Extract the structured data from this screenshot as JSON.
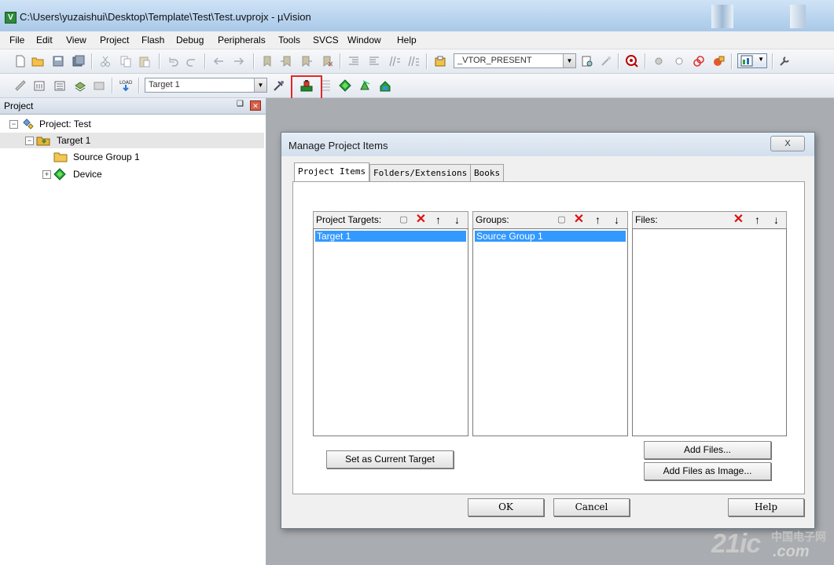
{
  "window": {
    "title": "C:\\Users\\yuzaishui\\Desktop\\Template\\Test\\Test.uvprojx - µVision"
  },
  "menu": [
    "File",
    "Edit",
    "View",
    "Project",
    "Flash",
    "Debug",
    "Peripherals",
    "Tools",
    "SVCS",
    "Window",
    "Help"
  ],
  "toolbar": {
    "define_combo": "_VTOR_PRESENT",
    "target_combo": "Target 1"
  },
  "project_panel": {
    "title": "Project",
    "pin_glyph": "❑",
    "close_glyph": "✕",
    "tree": {
      "project": "Project: Test",
      "target": "Target 1",
      "group": "Source Group 1",
      "device": "Device"
    }
  },
  "dialog": {
    "title": "Manage Project Items",
    "close_glyph": "X",
    "tabs": [
      "Project Items",
      "Folders/Extensions",
      "Books"
    ],
    "targets": {
      "label": "Project Targets:",
      "items": [
        "Target 1"
      ]
    },
    "groups": {
      "label": "Groups:",
      "items": [
        "Source Group 1"
      ]
    },
    "files": {
      "label": "Files:",
      "items": []
    },
    "buttons": {
      "set_current": "Set as Current Target",
      "add_files": "Add Files...",
      "add_image": "Add Files as Image...",
      "ok": "OK",
      "cancel": "Cancel",
      "help": "Help"
    }
  },
  "watermark": {
    "number": "21ic",
    "cn": "中国电子网",
    "com": ".com"
  },
  "colors": {
    "selection": "#3399ff",
    "highlight": "#e3262b",
    "workspace": "#a9acb0"
  }
}
